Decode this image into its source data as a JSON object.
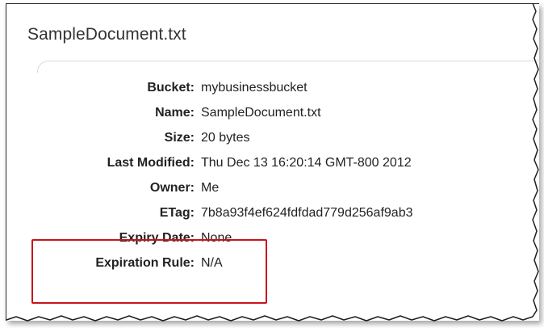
{
  "document": {
    "title": "SampleDocument.txt"
  },
  "properties": [
    {
      "label": "Bucket:",
      "value": "mybusinessbucket"
    },
    {
      "label": "Name:",
      "value": "SampleDocument.txt"
    },
    {
      "label": "Size:",
      "value": "20 bytes"
    },
    {
      "label": "Last Modified:",
      "value": "Thu Dec 13 16:20:14 GMT-800 2012"
    },
    {
      "label": "Owner:",
      "value": "Me"
    },
    {
      "label": "ETag:",
      "value": "7b8a93f4ef624fdfdad779d256af9ab3"
    },
    {
      "label": "Expiry Date:",
      "value": "None"
    },
    {
      "label": "Expiration Rule:",
      "value": "N/A"
    }
  ],
  "colors": {
    "highlight_border": "#c9141b",
    "text": "#222222"
  }
}
